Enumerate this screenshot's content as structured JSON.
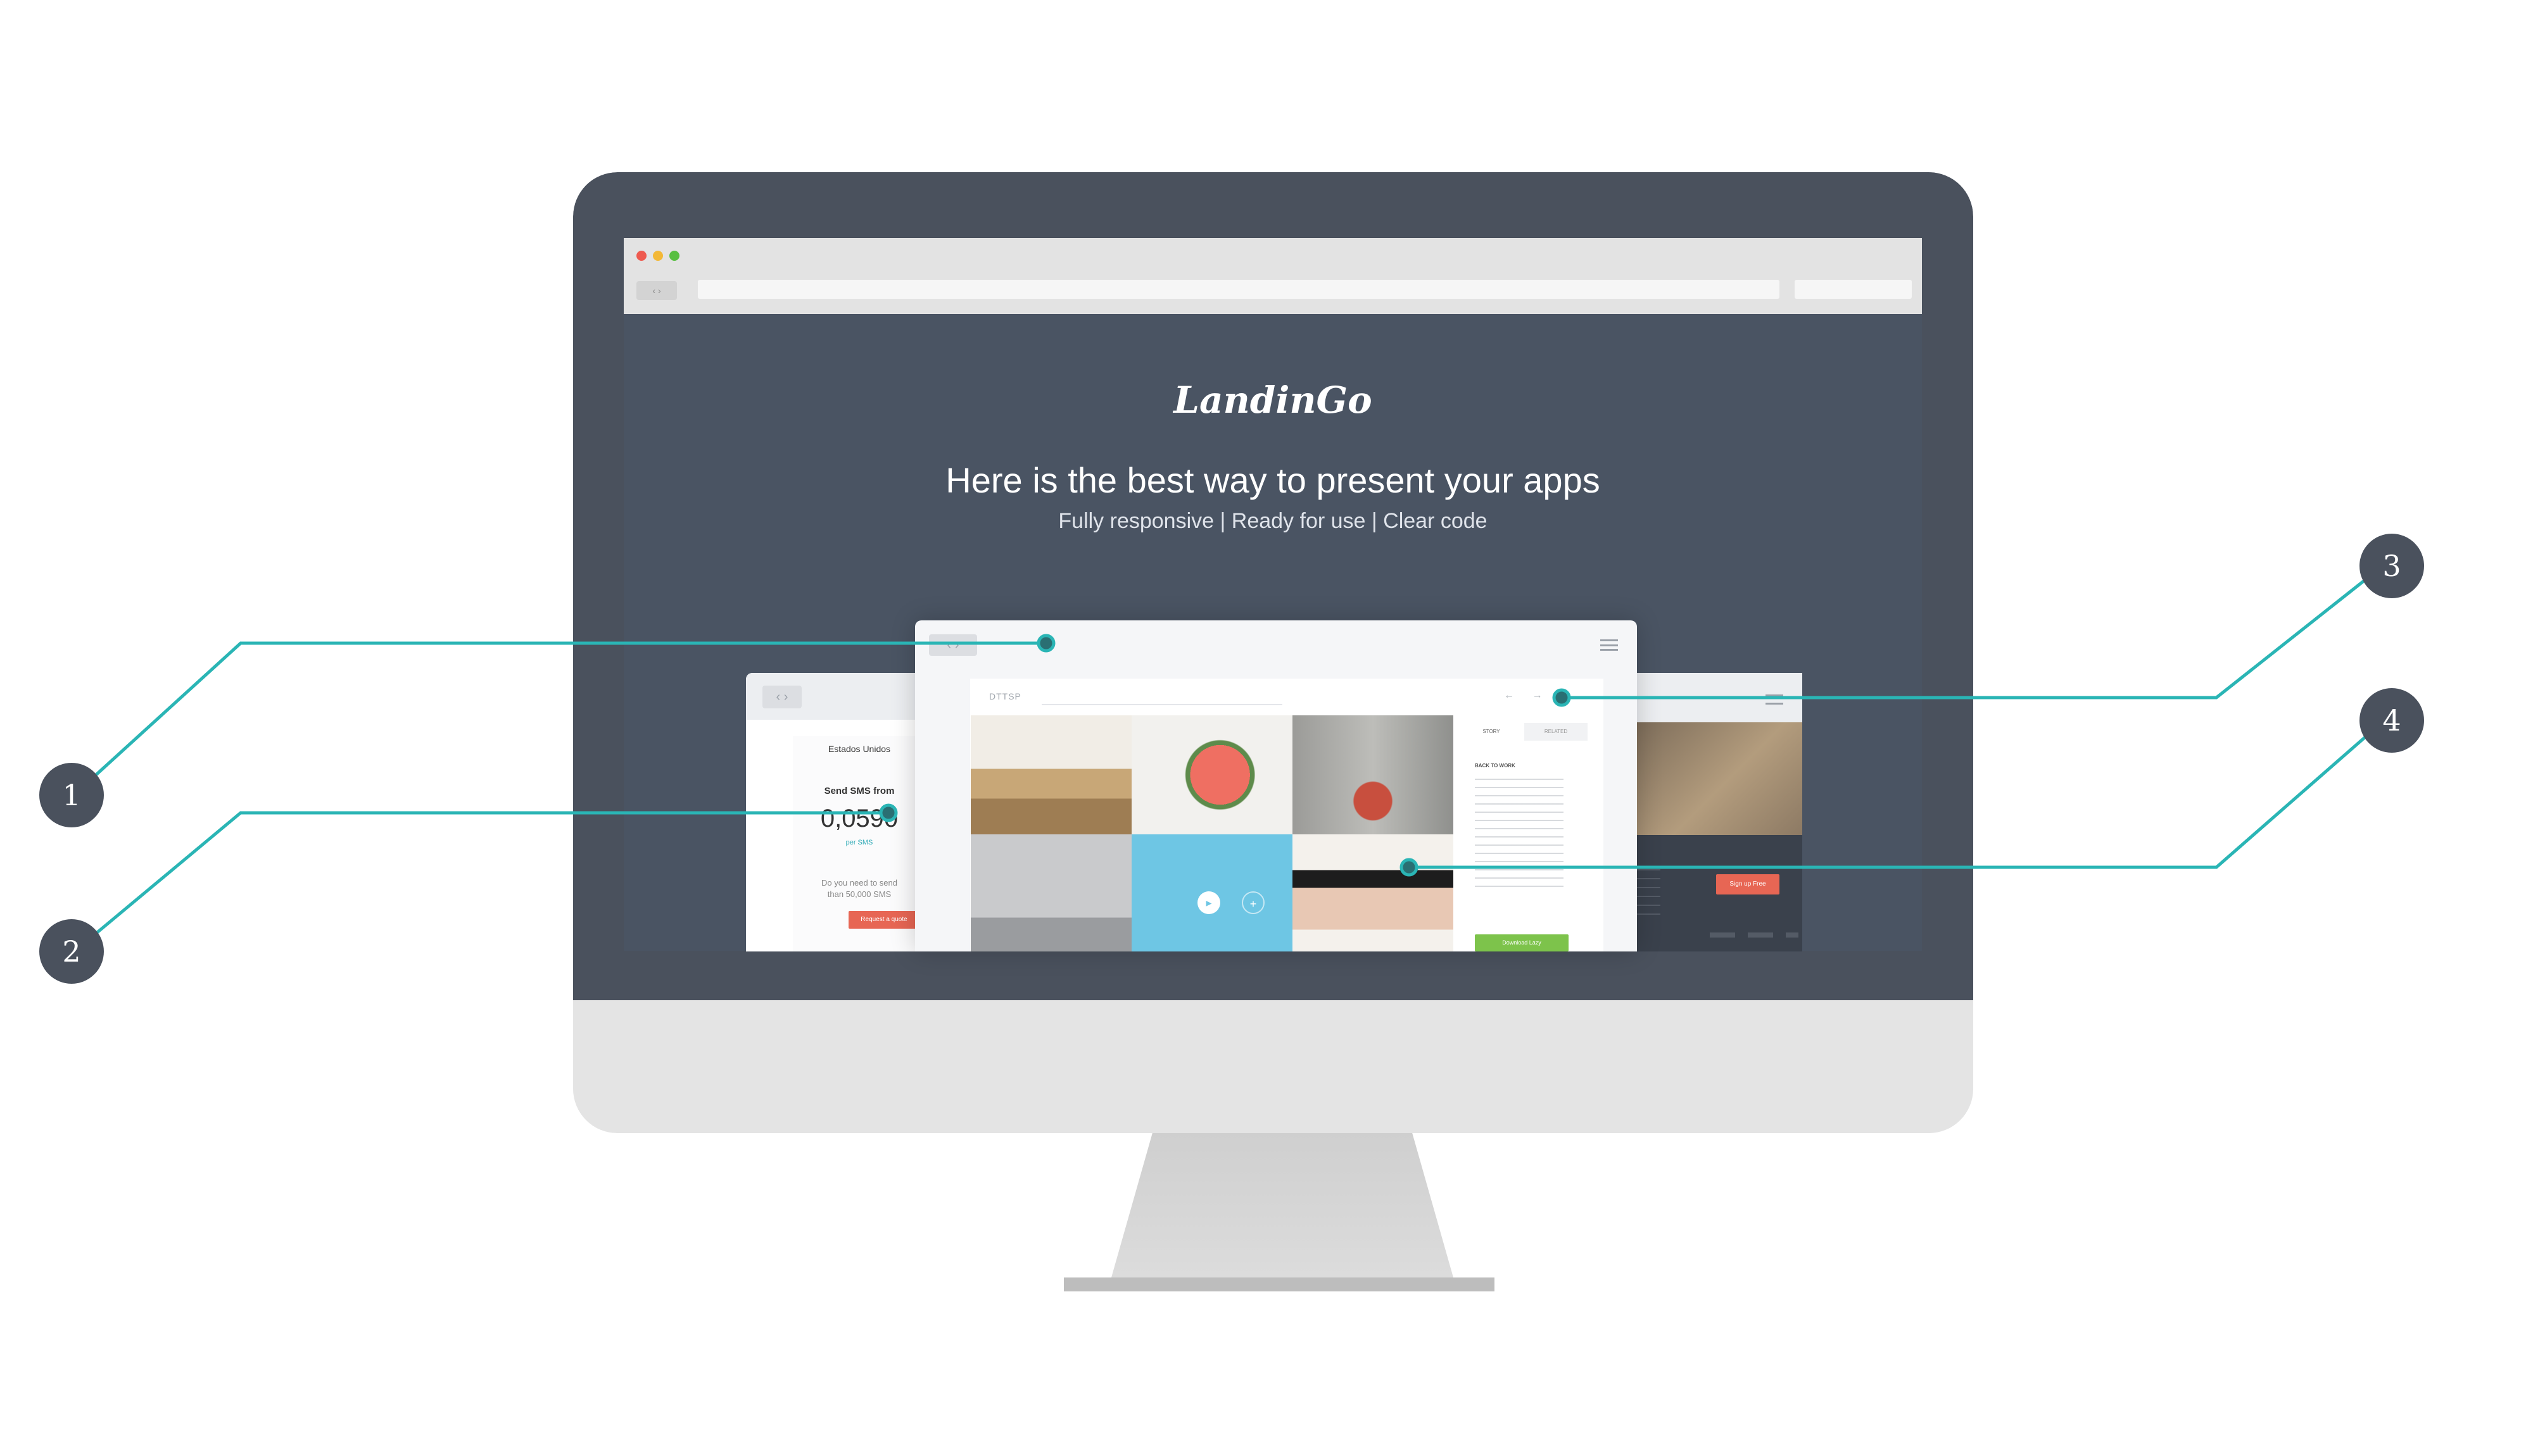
{
  "hero": {
    "logo": "LandinGo",
    "title": "Here is the best way to present your apps",
    "subtitle": "Fully responsive | Ready for use | Clear code"
  },
  "browser": {
    "nav_label": "‹ ›"
  },
  "left_app": {
    "nav_label": "‹ ›",
    "country": "Estados Unidos",
    "send_from": "Send SMS from",
    "price": "0,0590",
    "per_unit": "per SMS",
    "need_line1": "Do you need to send",
    "need_line2": "than 50,000 SMS",
    "quote_button": "Request a quote"
  },
  "right_app": {
    "signup_button": "Sign up Free"
  },
  "front_app": {
    "nav_label": "‹ ›",
    "brand": "DTTSP",
    "arrows": "← →",
    "tab_story": "STORY",
    "tab_related": "RELATED",
    "side_heading": "BACK TO WORK",
    "download_button": "Download Lazy",
    "play_icon": "▸",
    "plus_icon": "+"
  },
  "callouts": [
    "1",
    "2",
    "3",
    "4"
  ],
  "colors": {
    "bezel": "#4a515d",
    "accent_teal": "#2ab5b5",
    "cta_red": "#e76654",
    "cta_green": "#7dc34b",
    "tile_blue": "#6ec6e4"
  }
}
